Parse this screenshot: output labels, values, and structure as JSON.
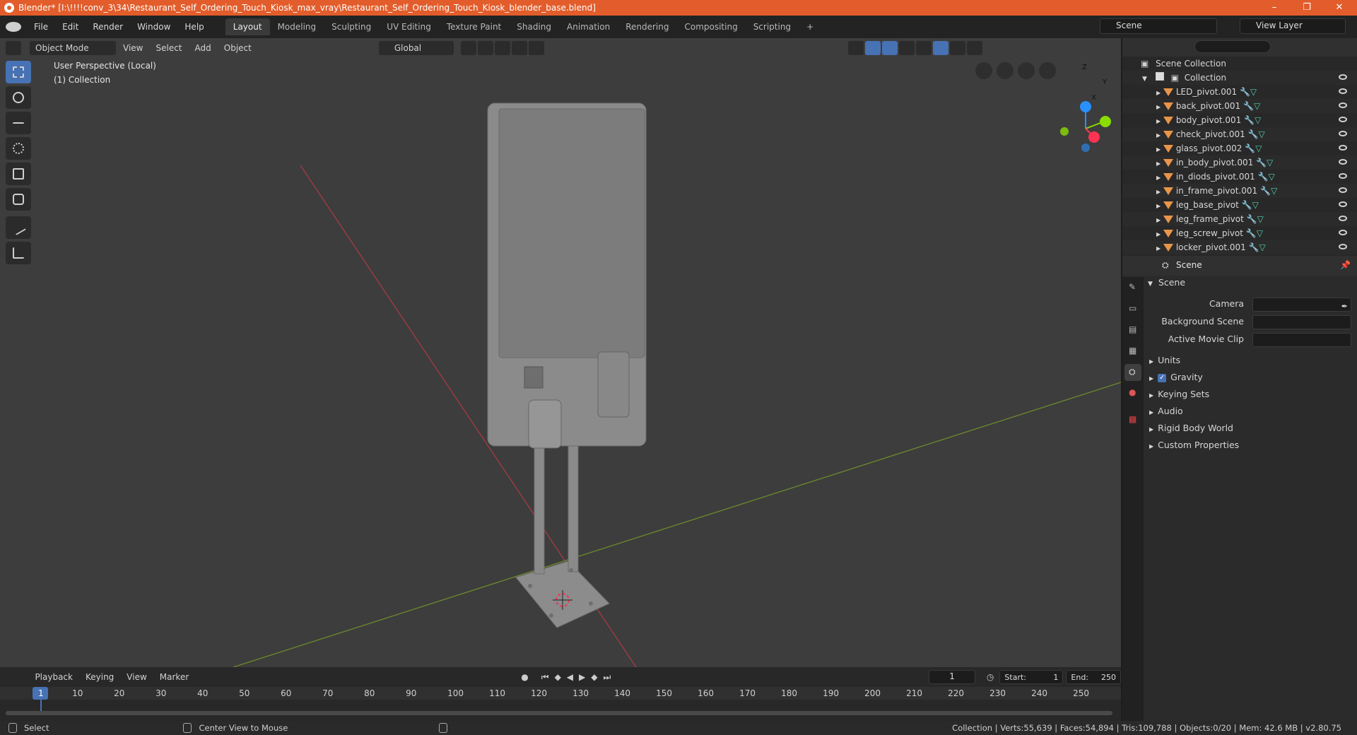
{
  "title_bar": {
    "text": "Blender* [I:\\!!!!conv_3\\34\\Restaurant_Self_Ordering_Touch_Kiosk_max_vray\\Restaurant_Self_Ordering_Touch_Kiosk_blender_base.blend]",
    "minimize": "–",
    "maximize": "❐",
    "close": "✕"
  },
  "menu": [
    "File",
    "Edit",
    "Render",
    "Window",
    "Help"
  ],
  "workspaces": [
    "Layout",
    "Modeling",
    "Sculpting",
    "UV Editing",
    "Texture Paint",
    "Shading",
    "Animation",
    "Rendering",
    "Compositing",
    "Scripting",
    "+"
  ],
  "scene_selector": "Scene",
  "view_layer": "View Layer",
  "viewport": {
    "mode": "Object Mode",
    "menus": [
      "View",
      "Select",
      "Add",
      "Object"
    ],
    "transform_orientation": "Global",
    "info_line1": "User Perspective (Local)",
    "info_line2": "(1) Collection",
    "gizmo": {
      "z": "Z",
      "y": "Y",
      "x": "X"
    }
  },
  "outliner": {
    "search_placeholder": "",
    "root": "Scene Collection",
    "collection": "Collection",
    "items": [
      "LED_pivot.001",
      "back_pivot.001",
      "body_pivot.001",
      "check_pivot.001",
      "glass_pivot.002",
      "in_body_pivot.001",
      "in_diods_pivot.001",
      "in_frame_pivot.001",
      "leg_base_pivot",
      "leg_frame_pivot",
      "leg_screw_pivot",
      "locker_pivot.001"
    ]
  },
  "properties": {
    "header": "Scene",
    "section": "Scene",
    "camera_label": "Camera",
    "background_scene_label": "Background Scene",
    "active_movie_clip_label": "Active Movie Clip",
    "panels": [
      "Units",
      "Gravity",
      "Keying Sets",
      "Audio",
      "Rigid Body World",
      "Custom Properties"
    ],
    "gravity_checked": true
  },
  "timeline": {
    "menus": [
      "Playback",
      "Keying",
      "View",
      "Marker"
    ],
    "current_frame": "1",
    "start_label": "Start:",
    "start": "1",
    "end_label": "End:",
    "end": "250",
    "ticks": [
      "1",
      "10",
      "20",
      "30",
      "40",
      "50",
      "60",
      "70",
      "80",
      "90",
      "100",
      "110",
      "120",
      "130",
      "140",
      "150",
      "160",
      "170",
      "180",
      "190",
      "200",
      "210",
      "220",
      "230",
      "240",
      "250"
    ]
  },
  "status_bar": {
    "select": "Select",
    "center_view": "Center View to Mouse",
    "stats": "Collection | Verts:55,639 | Faces:54,894 | Tris:109,788 | Objects:0/20 | Mem: 42.6 MB | v2.80.75"
  },
  "colors": {
    "accent": "#4772b3",
    "titlebar": "#e25d2b",
    "x_axis": "#ff3352",
    "y_axis": "#8bdc00",
    "z_axis": "#2890ff"
  }
}
